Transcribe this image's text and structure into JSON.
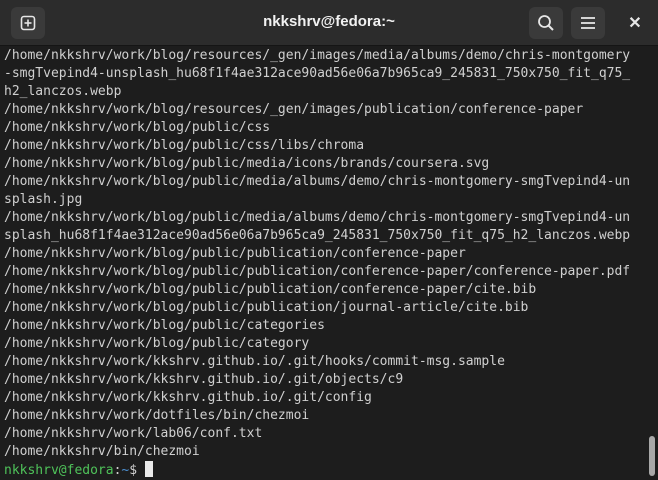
{
  "window": {
    "title": "nkkshrv@fedora:~",
    "icons": {
      "new_tab": "new-tab-icon",
      "search": "search-icon",
      "menu": "hamburger-menu-icon",
      "close": "close-icon"
    },
    "close_glyph": "✕"
  },
  "terminal": {
    "lines": [
      "/home/nkkshrv/work/blog/resources/_gen/images/media/albums/demo/chris-montgomery",
      "-smgTvepind4-unsplash_hu68f1f4ae312ace90ad56e06a7b965ca9_245831_750x750_fit_q75_",
      "h2_lanczos.webp",
      "/home/nkkshrv/work/blog/resources/_gen/images/publication/conference-paper",
      "/home/nkkshrv/work/blog/public/css",
      "/home/nkkshrv/work/blog/public/css/libs/chroma",
      "/home/nkkshrv/work/blog/public/media/icons/brands/coursera.svg",
      "/home/nkkshrv/work/blog/public/media/albums/demo/chris-montgomery-smgTvepind4-un",
      "splash.jpg",
      "/home/nkkshrv/work/blog/public/media/albums/demo/chris-montgomery-smgTvepind4-un",
      "splash_hu68f1f4ae312ace90ad56e06a7b965ca9_245831_750x750_fit_q75_h2_lanczos.webp",
      "/home/nkkshrv/work/blog/public/publication/conference-paper",
      "/home/nkkshrv/work/blog/public/publication/conference-paper/conference-paper.pdf",
      "/home/nkkshrv/work/blog/public/publication/conference-paper/cite.bib",
      "/home/nkkshrv/work/blog/public/publication/journal-article/cite.bib",
      "/home/nkkshrv/work/blog/public/categories",
      "/home/nkkshrv/work/blog/public/category",
      "/home/nkkshrv/work/kkshrv.github.io/.git/hooks/commit-msg.sample",
      "/home/nkkshrv/work/kkshrv.github.io/.git/objects/c9",
      "/home/nkkshrv/work/kkshrv.github.io/.git/config",
      "/home/nkkshrv/work/dotfiles/bin/chezmoi",
      "/home/nkkshrv/work/lab06/conf.txt",
      "/home/nkkshrv/bin/chezmoi"
    ],
    "prompt": {
      "user_host": "nkkshrv@fedora",
      "separator": ":",
      "path": "~",
      "symbol": "$ "
    },
    "colors": {
      "user_host": "#4fc35a",
      "path": "#4c8fd1",
      "text": "#d0d0d0",
      "background": "#1d1d1d"
    }
  }
}
